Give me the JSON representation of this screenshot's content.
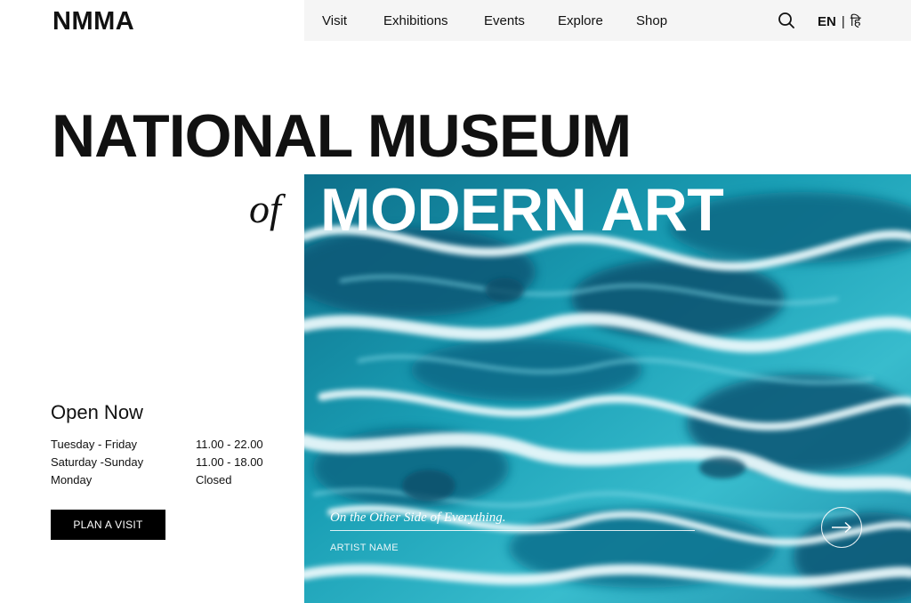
{
  "header": {
    "logo": "NMMA",
    "nav": [
      "Visit",
      "Exhibitions",
      "Events",
      "Explore",
      "Shop"
    ],
    "lang_en": "EN",
    "lang_sep": "|",
    "lang_hi": "हि"
  },
  "hero": {
    "title_line1": "NATIONAL MUSEUM",
    "title_of": "of",
    "title_line2": "MODERN ART",
    "caption": "On the Other Side of Everything.",
    "artist": "ARTIST NAME"
  },
  "hours": {
    "heading": "Open Now",
    "rows": [
      {
        "day": "Tuesday - Friday",
        "time": "11.00 - 22.00"
      },
      {
        "day": "Saturday -Sunday",
        "time": "11.00 - 18.00"
      },
      {
        "day": "Monday",
        "time": "Closed"
      }
    ]
  },
  "cta": {
    "plan_visit": "PLAN A VISIT"
  },
  "colors": {
    "accent_dark": "#000000",
    "nav_bg": "#f5f5f5",
    "artwork_teal": "#1ba4b8",
    "artwork_deep": "#0b5f7a"
  },
  "icons": {
    "search": "search-icon",
    "next": "arrow-right-icon"
  }
}
